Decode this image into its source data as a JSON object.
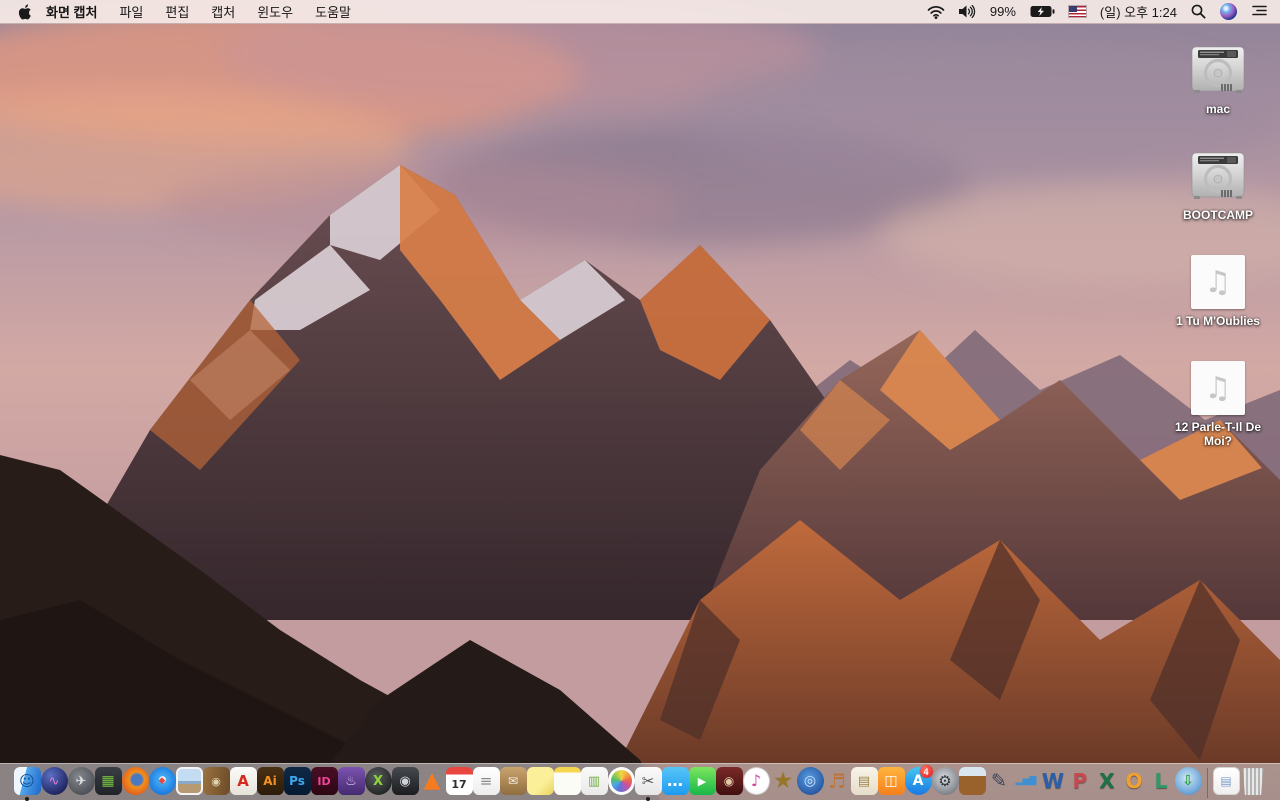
{
  "menu_bar": {
    "app_name": "화면 캡처",
    "menus": [
      "파일",
      "편집",
      "캡처",
      "윈도우",
      "도움말"
    ],
    "status": {
      "battery_percent": "99%",
      "clock": "(일) 오후 1:24",
      "icons": [
        "wifi-icon",
        "volume-icon",
        "battery-charging-icon",
        "us-flag-input-icon",
        "spotlight-icon",
        "siri-icon",
        "notification-center-icon"
      ]
    }
  },
  "desktop": {
    "audio_glyph": "♫",
    "icons": [
      {
        "label": "mac",
        "type": "hard-drive"
      },
      {
        "label": "BOOTCAMP",
        "type": "hard-drive"
      },
      {
        "label": "1 Tu M'Oublies",
        "type": "audio-file"
      },
      {
        "label": "12 Parle-T-Il De Moi?",
        "type": "audio-file"
      }
    ]
  },
  "dock": {
    "items": [
      {
        "name": "finder",
        "shape": "rsq",
        "bg": "linear-gradient(105deg,#eef6fd 0%,#eef6fd 38%,#55a8ea 38%,#1b66c9 100%)",
        "glyph": "☺",
        "fg": "#0f4f9e",
        "size": 15,
        "running": true
      },
      {
        "name": "siri",
        "shape": "circle",
        "bg": "radial-gradient(circle at 35% 30%,#5a6ec4,#232a66 70%,#12152f)",
        "glyph": "∿",
        "fg": "#e07bd6",
        "size": 13
      },
      {
        "name": "launchpad",
        "shape": "circle",
        "bg": "radial-gradient(circle at 40% 35%,#85898f,#3a3d42)",
        "glyph": "✈",
        "fg": "#e6e6e6",
        "size": 13
      },
      {
        "name": "mission-control",
        "shape": "rsq",
        "bg": "linear-gradient(#3a3f45,#202328)",
        "glyph": "▦",
        "fg": "#76c043",
        "size": 14
      },
      {
        "name": "firefox",
        "shape": "circle",
        "bg": "radial-gradient(circle at 55% 45%,#4a79c4 0 25%,#f08f1e 35%,#e3601a 72%,#b84a10)",
        "glyph": "",
        "fg": ""
      },
      {
        "name": "safari",
        "shape": "circle",
        "bg": "radial-gradient(circle at 50% 45%,#f2f8fd 0 15%,#41aaf2 18%,#1b77dd 75%,#0f5cc0)",
        "glyph": "◆",
        "fg": "#e8483f",
        "size": 9
      },
      {
        "name": "preview",
        "shape": "rsq",
        "bg": "linear-gradient(to bottom,#c3dcf2 0 50%,#8aa9c9 50% 62%,#b59a72 62% 100%)",
        "border": "2px solid #f4f4f4",
        "glyph": "",
        "fg": ""
      },
      {
        "name": "contacts",
        "shape": "rsq",
        "bg": "linear-gradient(100deg,#9b7342,#6b4a26)",
        "glyph": "◉",
        "fg": "#e3d3b2",
        "size": 11
      },
      {
        "name": "acrobat-reader",
        "shape": "rsq",
        "bg": "linear-gradient(#fbfbf9,#e6e3d8)",
        "glyph": "A",
        "fg": "#d6281e",
        "bold": true,
        "size": 15
      },
      {
        "name": "illustrator",
        "shape": "rsq",
        "bg": "linear-gradient(#4a3114,#2b1c0a)",
        "glyph": "Ai",
        "fg": "#f6921e",
        "bold": true,
        "size": 12
      },
      {
        "name": "photoshop",
        "shape": "rsq",
        "bg": "linear-gradient(#0e2a47,#071a30)",
        "glyph": "Ps",
        "fg": "#3fa8f0",
        "bold": true,
        "size": 12
      },
      {
        "name": "indesign",
        "shape": "rsq",
        "bg": "linear-gradient(#4a0e24,#2d0715)",
        "glyph": "ID",
        "fg": "#f0439a",
        "bold": true,
        "size": 11
      },
      {
        "name": "toast-burner",
        "shape": "rsq",
        "bg": "linear-gradient(#7b53b0,#452a70)",
        "glyph": "♨",
        "fg": "#d9cdf0",
        "size": 13
      },
      {
        "name": "x-media-app",
        "shape": "circle",
        "bg": "radial-gradient(circle at 40% 35%,#585b5e,#121314)",
        "glyph": "X",
        "fg": "#8ed437",
        "bold": true,
        "size": 13
      },
      {
        "name": "disk-tool-app",
        "shape": "rsq",
        "bg": "linear-gradient(#46494e,#1b1d20)",
        "glyph": "◉",
        "fg": "#cfd3d8",
        "size": 13
      },
      {
        "name": "vlc",
        "shape": "none",
        "bg": "",
        "glyph": "▲",
        "fg": "#f47b20",
        "size": 22
      },
      {
        "name": "calendar",
        "shape": "rsq",
        "bg": "linear-gradient(to bottom,#e8463f 0 27%,#ffffff 27%)",
        "glyph": "17",
        "fg": "#2e2e2e",
        "size": 11,
        "low": true,
        "bold": true
      },
      {
        "name": "reminders",
        "shape": "rsq",
        "bg": "linear-gradient(#ffffff,#ededed)",
        "glyph": "≡",
        "fg": "#8a8a8a",
        "size": 15
      },
      {
        "name": "archive-box-app",
        "shape": "rsq",
        "bg": "linear-gradient(#caa46e,#8f6d3f)",
        "glyph": "✉",
        "fg": "#f5efe2",
        "size": 12
      },
      {
        "name": "stickies",
        "shape": "rsq",
        "bg": "linear-gradient(135deg,#fbef9a 0 60%,#e8d05c)",
        "glyph": "",
        "fg": ""
      },
      {
        "name": "notes",
        "shape": "rsq",
        "bg": "linear-gradient(to bottom,#f6d64f 0 20%,#fcfcf7 20%)",
        "glyph": "",
        "fg": ""
      },
      {
        "name": "templates-app",
        "shape": "rsq",
        "bg": "linear-gradient(#fafafa,#e9e9e9)",
        "glyph": "▥",
        "fg": "#6fae3e",
        "size": 13
      },
      {
        "name": "photos",
        "shape": "circle",
        "bg": "conic-gradient(#f6d544,#f2a33c,#e96c4c,#d4508f,#9b5fc0,#5a74d8,#4aa8e8,#56bc6c,#a6cc4a,#f6d544)",
        "border": "3px solid #fbfbfb",
        "glyph": "",
        "fg": ""
      },
      {
        "name": "screen-capture-grab",
        "shape": "rsq",
        "bg": "linear-gradient(#fbfbfb,#e6e6e6)",
        "glyph": "✂",
        "fg": "#4f4f4f",
        "size": 15,
        "running": true
      },
      {
        "name": "messages",
        "shape": "rsq",
        "bg": "linear-gradient(#57c5f7,#1d9bf0)",
        "glyph": "…",
        "fg": "#ffffff",
        "bold": true,
        "size": 16
      },
      {
        "name": "facetime",
        "shape": "rsq",
        "bg": "linear-gradient(#7ce55f,#18b748)",
        "glyph": "▶",
        "fg": "#ffffff",
        "size": 11
      },
      {
        "name": "photo-booth",
        "shape": "rsq",
        "bg": "linear-gradient(#7a2a28,#420f10)",
        "glyph": "◉",
        "fg": "#e3cba6",
        "size": 12
      },
      {
        "name": "itunes",
        "shape": "circle",
        "bg": "radial-gradient(circle at 50% 40%,#ffffff 0 60%,#efefef)",
        "border": "1px solid #cfcfcf",
        "glyph": "♪",
        "fg": "#d0459c",
        "size": 16
      },
      {
        "name": "imovie-star",
        "shape": "none",
        "bg": "",
        "glyph": "★",
        "fg": "#96762a",
        "size": 23
      },
      {
        "name": "dvd-video-app",
        "shape": "circle",
        "bg": "radial-gradient(circle at 45% 40%,#5a9de0,#153f8c)",
        "glyph": "◎",
        "fg": "#cfe2ff",
        "size": 14
      },
      {
        "name": "garageband",
        "shape": "none",
        "bg": "",
        "glyph": "♬",
        "fg": "#bd7438",
        "size": 20
      },
      {
        "name": "clippings-app",
        "shape": "rsq",
        "bg": "linear-gradient(#f8f4ea,#e6ddc9)",
        "glyph": "▤",
        "fg": "#a0854e",
        "size": 13
      },
      {
        "name": "ibooks",
        "shape": "rsq",
        "bg": "linear-gradient(#ffb53e,#f57f1d)",
        "glyph": "◫",
        "fg": "#ffffff",
        "size": 14
      },
      {
        "name": "app-store",
        "shape": "circle",
        "bg": "linear-gradient(#43c6f4,#1a78e2)",
        "glyph": "A",
        "fg": "#ffffff",
        "bold": true,
        "size": 14,
        "badge": "4"
      },
      {
        "name": "system-preferences",
        "shape": "circle",
        "bg": "radial-gradient(circle at 45% 40%,#d8dbdf,#82868c 70%,#54585e)",
        "glyph": "⚙",
        "fg": "#33363b",
        "size": 15
      },
      {
        "name": "keynote",
        "shape": "rsq",
        "bg": "linear-gradient(to bottom,#d9e6f0 0 32%,#99622c 32%)",
        "glyph": "",
        "fg": ""
      },
      {
        "name": "pages",
        "shape": "none",
        "bg": "",
        "glyph": "✎",
        "fg": "#3a465a",
        "size": 19
      },
      {
        "name": "numbers",
        "shape": "none",
        "bg": "",
        "glyph": "▂▅▇",
        "fg": "#3f8fd2",
        "size": 9,
        "bold": true
      },
      {
        "name": "ms-word",
        "shape": "none",
        "bg": "",
        "glyph": "W",
        "fg": "#2b5ea7",
        "bold": true,
        "size": 20,
        "shadow": true
      },
      {
        "name": "ms-powerpoint",
        "shape": "none",
        "bg": "",
        "glyph": "P",
        "fg": "#c9484f",
        "bold": true,
        "size": 20,
        "shadow": true
      },
      {
        "name": "ms-excel",
        "shape": "none",
        "bg": "",
        "glyph": "X",
        "fg": "#1e7145",
        "bold": true,
        "size": 20,
        "shadow": true
      },
      {
        "name": "ms-outlook",
        "shape": "none",
        "bg": "",
        "glyph": "O",
        "fg": "#f0a030",
        "bold": true,
        "size": 20,
        "shadow": true
      },
      {
        "name": "ms-lync",
        "shape": "none",
        "bg": "",
        "glyph": "L",
        "fg": "#2a9a68",
        "bold": true,
        "size": 20,
        "shadow": true
      },
      {
        "name": "downloader-globe",
        "shape": "circle",
        "bg": "radial-gradient(circle at 45% 40%,#cfe8f7,#68a1d6 70%,#39699f)",
        "glyph": "⇩",
        "fg": "#2f9e3a",
        "bold": true,
        "size": 14
      },
      {
        "name": "dock-divider",
        "type": "divider"
      },
      {
        "name": "document-file",
        "shape": "rsq",
        "bg": "linear-gradient(#ffffff,#efefef)",
        "border": "1px solid #d4d4d4",
        "glyph": "▤",
        "fg": "#7a9cc9",
        "size": 12
      },
      {
        "name": "trash-full",
        "shape": "trash",
        "bg": "repeating-linear-gradient(90deg,#e8e8e8 0 2px,#b4b4b4 2px 4px)",
        "glyph": "",
        "fg": ""
      }
    ]
  }
}
